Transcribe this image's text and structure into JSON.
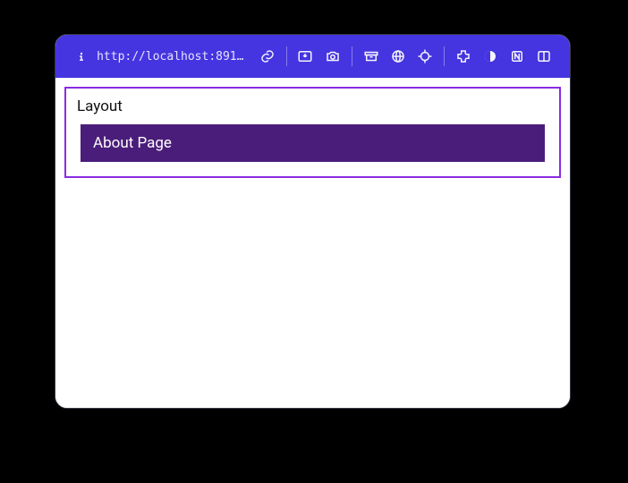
{
  "toolbar": {
    "url": "http://localhost:8910/abo…",
    "icons": {
      "info": "info-icon",
      "link": "link-icon",
      "download": "download-icon",
      "camera": "camera-icon",
      "archive": "archive-icon",
      "globe": "globe-icon",
      "crosshair": "crosshair-icon",
      "puzzle": "extensions-icon",
      "moon": "darkmode-icon",
      "notion": "notion-icon",
      "panel": "panel-icon"
    }
  },
  "page": {
    "layout_label": "Layout",
    "page_title": "About Page"
  }
}
